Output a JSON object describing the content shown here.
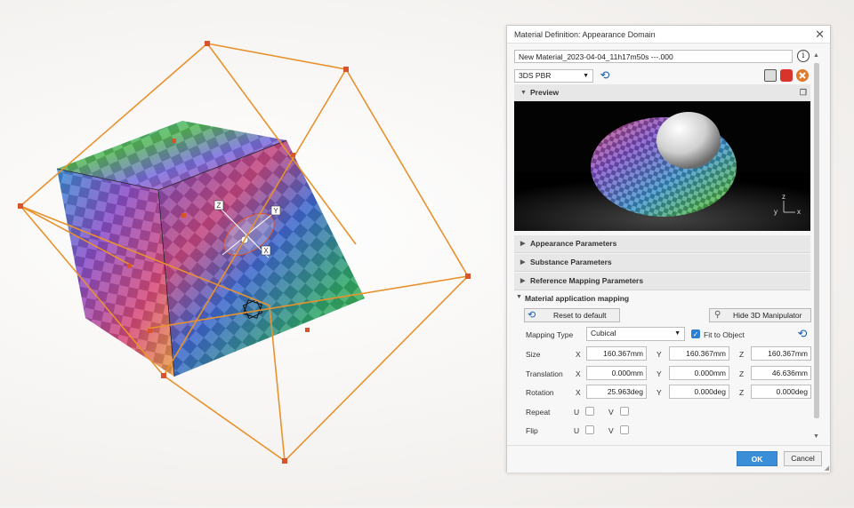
{
  "dialog": {
    "title": "Material Definition: Appearance Domain",
    "material_name": "New Material_2023-04-04_11h17m50s ---.000",
    "renderer": "3DS PBR",
    "preview_label": "Preview",
    "sections": {
      "appearance": "Appearance Parameters",
      "substance": "Substance Parameters",
      "reference": "Reference Mapping Parameters",
      "application": "Material application mapping"
    },
    "reset_label": "Reset to default",
    "hide_manip_label": "Hide 3D Manipulator",
    "mapping": {
      "type_label": "Mapping Type",
      "type_value": "Cubical",
      "fit_label": "Fit to Object",
      "fit_checked": true,
      "size_label": "Size",
      "translation_label": "Translation",
      "rotation_label": "Rotation",
      "repeat_label": "Repeat",
      "flip_label": "Flip",
      "x": "X",
      "y": "Y",
      "z": "Z",
      "u": "U",
      "v": "V",
      "size": {
        "x": "160.367mm",
        "y": "160.367mm",
        "z": "160.367mm"
      },
      "translation": {
        "x": "0.000mm",
        "y": "0.000mm",
        "z": "46.636mm"
      },
      "rotation": {
        "x": "25.963deg",
        "y": "0.000deg",
        "z": "0.000deg"
      }
    },
    "preview_axes": {
      "z": "z",
      "y": "y",
      "x": "x"
    },
    "ok_label": "OK",
    "cancel_label": "Cancel"
  },
  "viewport": {
    "manipulator_labels": {
      "z": "Z",
      "y": "Y",
      "x": "X"
    },
    "accent_color": "#e8922e",
    "handle_color": "#d9532b"
  },
  "icons": {
    "close": "close-icon",
    "info": "info-icon",
    "undo": "undo-icon"
  }
}
